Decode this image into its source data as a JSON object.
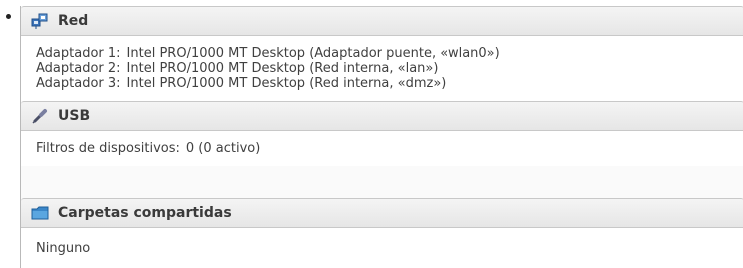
{
  "sections": {
    "red": {
      "title": "Red",
      "icon": "network-icon",
      "rows": [
        {
          "label": "Adaptador 1:",
          "value": "Intel PRO/1000 MT Desktop (Adaptador puente, «wlan0»)"
        },
        {
          "label": "Adaptador 2:",
          "value": "Intel PRO/1000 MT Desktop (Red interna, «lan»)"
        },
        {
          "label": "Adaptador 3:",
          "value": "Intel PRO/1000 MT Desktop (Red interna, «dmz»)"
        }
      ]
    },
    "usb": {
      "title": "USB",
      "icon": "usb-plug-icon",
      "rows": [
        {
          "label": "Filtros de dispositivos:",
          "value": "0 (0 activo)"
        }
      ]
    },
    "shared": {
      "title": "Carpetas compartidas",
      "icon": "folder-icon",
      "rows": [
        {
          "value": "Ninguno"
        }
      ]
    }
  },
  "colors": {
    "header_bg": "#e9e9e9",
    "folder_blue": "#4a90c8",
    "network_blue": "#3b73b9"
  }
}
